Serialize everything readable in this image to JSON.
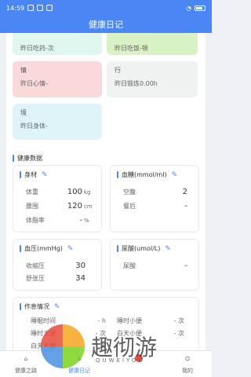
{
  "status": {
    "time": "14:59",
    "battery": ""
  },
  "header": {
    "title": "健康日记"
  },
  "top_tiles": [
    {
      "title": "",
      "value": "昨日吃药-次",
      "color": "#dff7ef"
    },
    {
      "title": "",
      "value": "昨日吃饭-顿",
      "color": "#d8f1c5"
    },
    {
      "title": "情",
      "value": "昨日心情-",
      "color": "#f9d9d9"
    },
    {
      "title": "行",
      "value": "昨日锻炼0.00h",
      "color": "#eef3f1"
    },
    {
      "title": "境",
      "value": "昨日身体-",
      "color": "#dff4f8"
    }
  ],
  "health": {
    "title": "健康数据",
    "body": {
      "title": "身材",
      "rows": [
        {
          "label": "体重",
          "value": "100",
          "unit": "kg"
        },
        {
          "label": "腰围",
          "value": "120",
          "unit": "cm"
        },
        {
          "label": "体脂率",
          "value": "-",
          "unit": "%"
        }
      ]
    },
    "sugar": {
      "title": "血糖(mmol/ml)",
      "rows": [
        {
          "label": "空腹",
          "value": "2",
          "unit": ""
        },
        {
          "label": "餐后",
          "value": "-",
          "unit": ""
        }
      ]
    },
    "pressure": {
      "title": "血压(mmHg)",
      "rows": [
        {
          "label": "收缩压",
          "value": "30",
          "unit": ""
        },
        {
          "label": "舒张压",
          "value": "34",
          "unit": ""
        }
      ]
    },
    "uric": {
      "title": "尿酸(umol/L)",
      "rows": [
        {
          "label": "尿酸",
          "value": "-",
          "unit": ""
        }
      ]
    },
    "routine": {
      "title": "作息情况",
      "rows": [
        {
          "label": "睡眠时间",
          "value": "- h"
        },
        {
          "label": "睡时小便",
          "value": "- 次"
        },
        {
          "label": "睡时大便",
          "value": "- 次"
        },
        {
          "label": "白天小便",
          "value": "- 次"
        },
        {
          "label": "白天大便",
          "value": "- 次"
        }
      ]
    }
  },
  "tabs": [
    {
      "label": "健康之路"
    },
    {
      "label": "健康日记"
    },
    {
      "label": ""
    },
    {
      "label": "我的"
    }
  ],
  "watermark": {
    "text": "趣彻游",
    "sub": "QUWEIYOU"
  }
}
